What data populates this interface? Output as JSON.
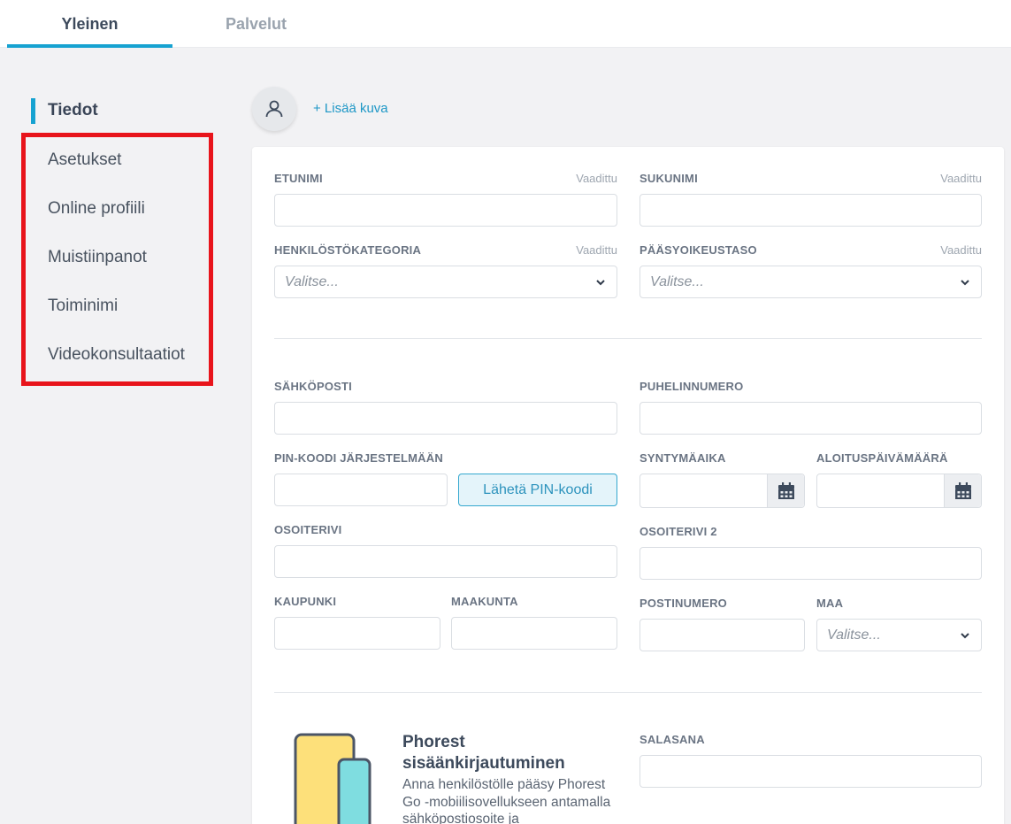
{
  "tabs": [
    {
      "label": "Yleinen",
      "active": true
    },
    {
      "label": "Palvelut",
      "active": false
    }
  ],
  "sidebar": {
    "items": [
      {
        "label": "Tiedot",
        "active": true
      },
      {
        "label": "Asetukset"
      },
      {
        "label": "Online profiili"
      },
      {
        "label": "Muistiinpanot"
      },
      {
        "label": "Toiminimi"
      },
      {
        "label": "Videokonsultaatiot"
      }
    ]
  },
  "avatar": {
    "add_label": "+ Lisää kuva"
  },
  "form": {
    "required": "Vaadittu",
    "select_placeholder": "Valitse...",
    "first_name": {
      "label": "ETUNIMI",
      "value": ""
    },
    "last_name": {
      "label": "SUKUNIMI",
      "value": ""
    },
    "staff_category": {
      "label": "HENKILÖSTÖKATEGORIA"
    },
    "access_level": {
      "label": "PÄÄSYOIKEUSTASO"
    },
    "email": {
      "label": "SÄHKÖPOSTI",
      "value": ""
    },
    "phone": {
      "label": "PUHELINNUMERO",
      "value": ""
    },
    "pin": {
      "label": "PIN-KOODI JÄRJESTELMÄÄN",
      "value": "",
      "button": "Lähetä PIN-koodi"
    },
    "birthdate": {
      "label": "SYNTYMÄAIKA",
      "value": ""
    },
    "start_date": {
      "label": "ALOITUSPÄIVÄMÄÄRÄ",
      "value": ""
    },
    "address1": {
      "label": "OSOITERIVI",
      "value": ""
    },
    "address2": {
      "label": "OSOITERIVI 2",
      "value": ""
    },
    "city": {
      "label": "KAUPUNKI",
      "value": ""
    },
    "region": {
      "label": "MAAKUNTA",
      "value": ""
    },
    "postcode": {
      "label": "POSTINUMERO",
      "value": ""
    },
    "country": {
      "label": "MAA"
    },
    "password": {
      "label": "SALASANA",
      "value": ""
    }
  },
  "promo": {
    "title": "Phorest sisäänkirjautuminen",
    "text": "Anna henkilöstölle pääsy Phorest Go -mobiilisovellukseen antamalla sähköpostiosoite ja"
  },
  "colors": {
    "accent": "#16a2d1",
    "highlight": "#e8141b"
  }
}
